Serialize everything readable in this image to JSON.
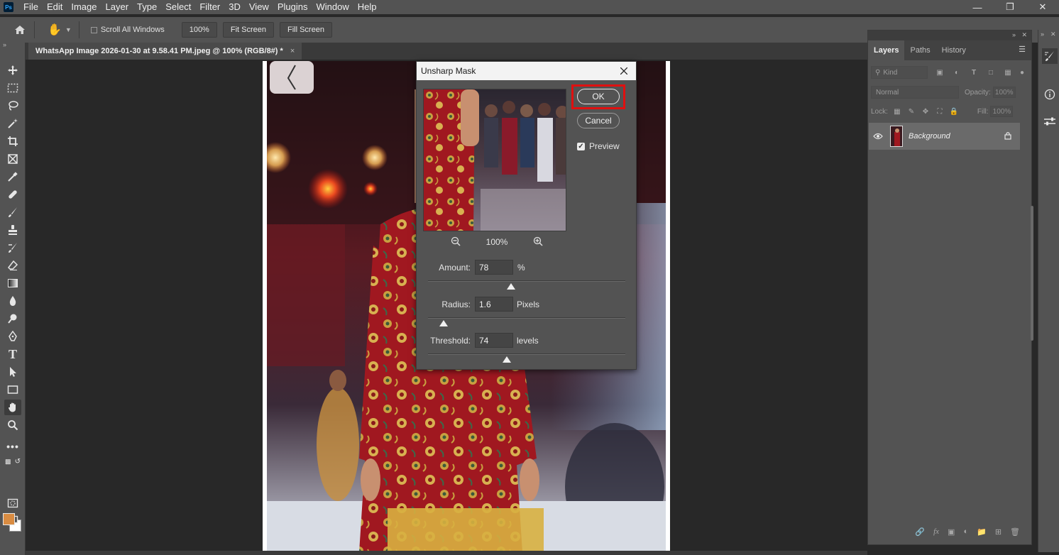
{
  "menu": {
    "logo": "Ps",
    "items": [
      "File",
      "Edit",
      "Image",
      "Layer",
      "Type",
      "Select",
      "Filter",
      "3D",
      "View",
      "Plugins",
      "Window",
      "Help"
    ]
  },
  "options": {
    "scroll_all_windows": "Scroll All Windows",
    "zoom_100": "100%",
    "fit_screen": "Fit Screen",
    "fill_screen": "Fill Screen"
  },
  "document": {
    "tab_title": "WhatsApp Image 2026-01-30 at 9.58.41 PM.jpeg @ 100% (RGB/8#) *",
    "close": "×"
  },
  "dialog": {
    "title": "Unsharp Mask",
    "ok": "OK",
    "cancel": "Cancel",
    "preview_label": "Preview",
    "preview_checked": true,
    "zoom": "100%",
    "amount": {
      "label": "Amount:",
      "value": "78",
      "unit": "%",
      "slider_fraction": 0.42
    },
    "radius": {
      "label": "Radius:",
      "value": "1.6",
      "unit": "Pixels",
      "slider_fraction": 0.08
    },
    "threshold": {
      "label": "Threshold:",
      "value": "74",
      "unit": "levels",
      "slider_fraction": 0.4
    }
  },
  "layers_panel": {
    "tabs": [
      "Layers",
      "Paths",
      "History"
    ],
    "active_tab": "Layers",
    "kind": "Kind",
    "blend_mode": "Normal",
    "opacity_label": "Opacity:",
    "opacity_value": "100%",
    "lock_label": "Lock:",
    "fill_label": "Fill:",
    "fill_value": "100%",
    "layer_name": "Background"
  },
  "colors": {
    "foreground": "#d98c42",
    "background": "#ffffff",
    "highlight": "#e01010"
  }
}
